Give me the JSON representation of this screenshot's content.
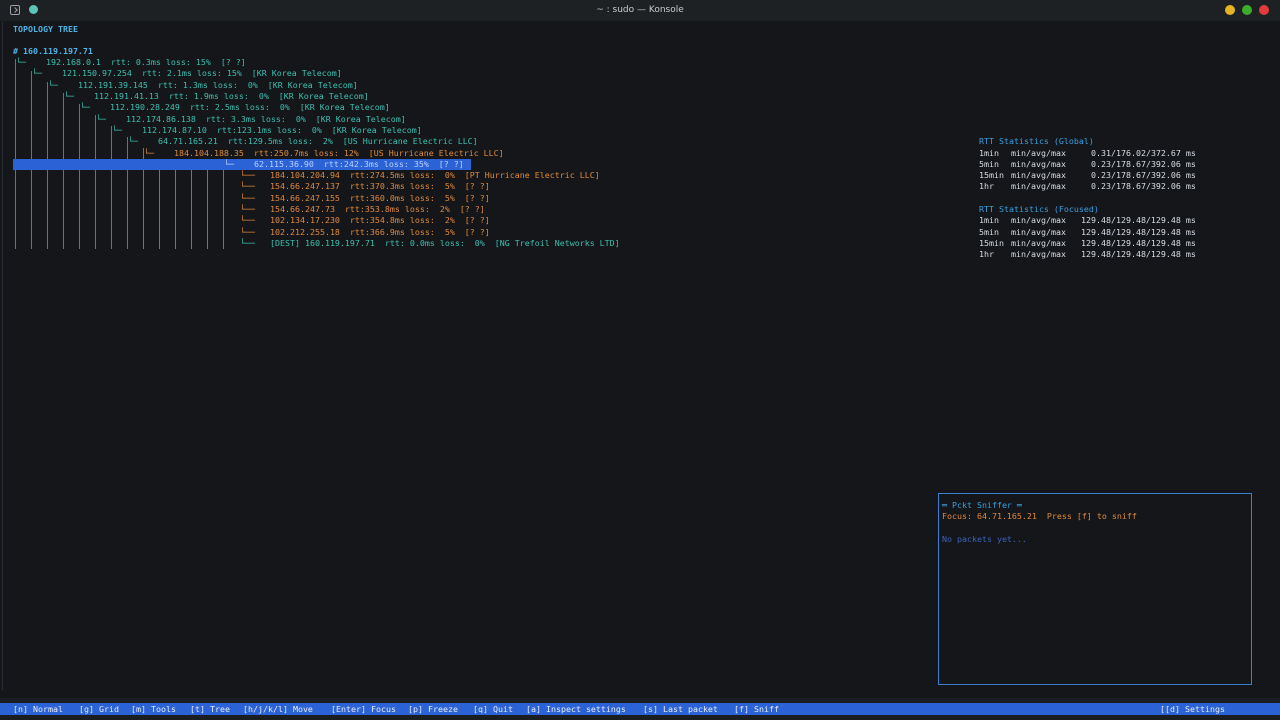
{
  "window": {
    "title": "~ : sudo — Konsole",
    "icons": [
      "terminal-app-icon",
      "pin-icon",
      "minimize-icon",
      "maximize-icon",
      "close-icon"
    ],
    "colors": {
      "minimize": "#e5b422",
      "maximize": "#3dae2b",
      "close": "#e23b3b"
    }
  },
  "topology": {
    "header": "TOPOLOGY TREE",
    "root": "# 160.119.197.71",
    "rows": [
      {
        "prefix": "└─",
        "text": "192.168.0.1  rtt: 0.3ms loss: 15%  [? ?]"
      },
      {
        "prefix": "└─",
        "text": "121.150.97.254  rtt: 2.1ms loss: 15%  [KR Korea Telecom]"
      },
      {
        "prefix": "└─",
        "text": "112.191.39.145  rtt: 1.3ms loss:  0%  [KR Korea Telecom]"
      },
      {
        "prefix": "└─",
        "text": "112.191.41.13  rtt: 1.9ms loss:  0%  [KR Korea Telecom]"
      },
      {
        "prefix": "└─",
        "text": "112.190.28.249  rtt: 2.5ms loss:  0%  [KR Korea Telecom]"
      },
      {
        "prefix": "└─",
        "text": "112.174.86.138  rtt: 3.3ms loss:  0%  [KR Korea Telecom]"
      },
      {
        "prefix": "└─",
        "text": "112.174.87.10  rtt:123.1ms loss:  0%  [KR Korea Telecom]"
      },
      {
        "prefix": "└─",
        "text": "64.71.165.21  rtt:129.5ms loss:  2%  [US Hurricane Electric LLC]"
      },
      {
        "prefix": "└─",
        "text": "184.104.188.35  rtt:250.7ms loss: 12%  [US Hurricane Electric LLC]"
      },
      {
        "prefix": "└─",
        "text": "62.115.36.90  rtt:242.3ms loss: 35%  [? ?]"
      },
      {
        "prefix": "└──",
        "text": "184.104.204.94  rtt:274.5ms loss:  0%  [PT Hurricane Electric LLC]"
      },
      {
        "prefix": "└──",
        "text": "154.66.247.137  rtt:370.3ms loss:  5%  [? ?]"
      },
      {
        "prefix": "└──",
        "text": "154.66.247.155  rtt:360.0ms loss:  5%  [? ?]"
      },
      {
        "prefix": "└──",
        "text": "154.66.247.73  rtt:353.8ms loss:  2%  [? ?]"
      },
      {
        "prefix": "└──",
        "text": "102.134.17.230  rtt:354.8ms loss:  2%  [? ?]"
      },
      {
        "prefix": "└──",
        "text": "102.212.255.18  rtt:366.9ms loss:  5%  [? ?]"
      },
      {
        "prefix": "└──",
        "text": "[DEST] 160.119.197.71  rtt: 0.0ms loss:  0%  [NG Trefoil Networks LTD]"
      }
    ]
  },
  "rtt_global": {
    "title": "RTT Statistics (Global)",
    "rows": [
      {
        "period": "1min",
        "label": "min/avg/max",
        "value": "0.31/176.02/372.67 ms"
      },
      {
        "period": "5min",
        "label": "min/avg/max",
        "value": "0.23/178.67/392.06 ms"
      },
      {
        "period": "15min",
        "label": "min/avg/max",
        "value": "0.23/178.67/392.06 ms"
      },
      {
        "period": "1hr",
        "label": "min/avg/max",
        "value": "0.23/178.67/392.06 ms"
      }
    ]
  },
  "rtt_focused": {
    "title": "RTT Statistics (Focused)",
    "rows": [
      {
        "period": "1min",
        "label": "min/avg/max",
        "value": "129.48/129.48/129.48 ms"
      },
      {
        "period": "5min",
        "label": "min/avg/max",
        "value": "129.48/129.48/129.48 ms"
      },
      {
        "period": "15min",
        "label": "min/avg/max",
        "value": "129.48/129.48/129.48 ms"
      },
      {
        "period": "1hr",
        "label": "min/avg/max",
        "value": "129.48/129.48/129.48 ms"
      }
    ]
  },
  "sniffer": {
    "title": "═ Pckt Sniffer ═",
    "focus": "Focus: 64.71.165.21  Press [f] to sniff",
    "empty": "No packets yet..."
  },
  "statusbar": {
    "items": [
      "[n] Normal",
      "[g] Grid",
      "[m] Tools",
      "[t] Tree",
      "[h/j/k/l] Move",
      "[Enter] Focus",
      "[p] Freeze",
      "[q] Quit",
      "[a] Inspect settings",
      "[s] Last packet",
      "[f] Sniff"
    ],
    "settings": "[[d] Settings"
  }
}
